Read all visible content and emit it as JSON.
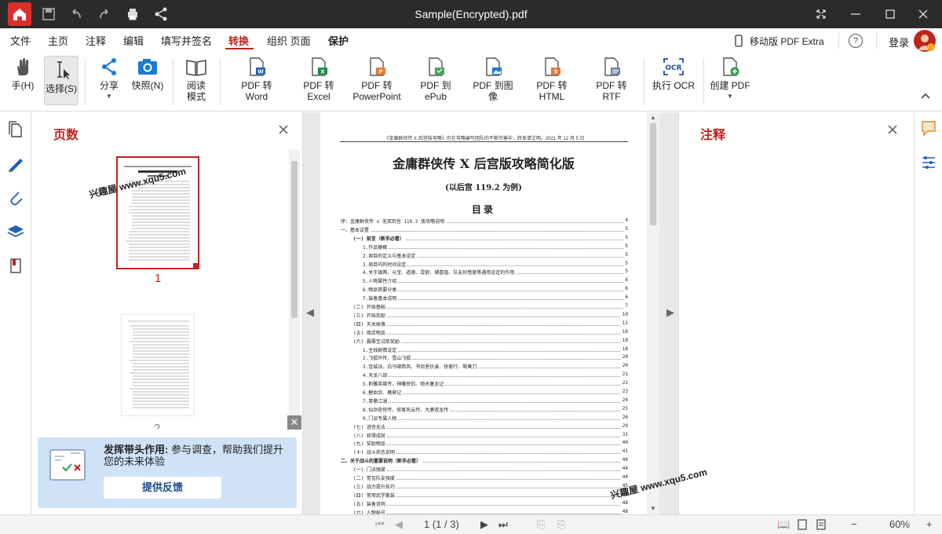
{
  "window": {
    "title": "Sample(Encrypted).pdf"
  },
  "menu": {
    "items": [
      "文件",
      "主页",
      "注释",
      "编辑",
      "填写并签名",
      "转换",
      "组织 页面",
      "保护"
    ],
    "active": "转换",
    "mobile_label": "移动版 PDF Extra",
    "help_label": "?",
    "login_label": "登录"
  },
  "ribbon": {
    "hand": "手(H)",
    "select": "选择(S)",
    "share": "分享",
    "snapshot": "快照(N)",
    "read_mode_1": "阅读",
    "read_mode_2": "模式",
    "pdf_word": "PDF 转 Word",
    "pdf_excel": "PDF 转 Excel",
    "pdf_ppt_1": "PDF 转",
    "pdf_ppt_2": "PowerPoint",
    "pdf_epub": "PDF 到 ePub",
    "pdf_image": "PDF 到图像",
    "pdf_html": "PDF 转 HTML",
    "pdf_rtf": "PDF 转 RTF",
    "ocr": "执行 OCR",
    "ocr_badge": "OCR",
    "create_pdf": "创建 PDF"
  },
  "pages_panel": {
    "title": "页数",
    "page1": "1",
    "page2": "2"
  },
  "feedback": {
    "title_bold": "发挥带头作用:",
    "title_rest": "参与调查，帮助我们提升您的未来体验",
    "button": "提供反馈"
  },
  "annotations_panel": {
    "title": "注释"
  },
  "document": {
    "header": "《金庸群侠传 X 后宫版攻略》仍在攻略编写团队的不断完善中，转发请注明。2021 年 12 月 5 日",
    "title": "金庸群侠传 X 后宫版攻略简化版",
    "subtitle": "(以后宫 119.2 为例)",
    "toc_heading": "目录",
    "toc": [
      {
        "text": "序：金庸群侠传 x 无双后宫 119.2 版攻略说明",
        "page": "4",
        "level": 0
      },
      {
        "text": "一、基本设置",
        "page": "5",
        "level": 0
      },
      {
        "text": "(一) 前言（新手必看）",
        "page": "5",
        "level": 1
      },
      {
        "text": "1.作品梗概",
        "page": "5",
        "level": 2
      },
      {
        "text": "2.周目的定义与基本设定",
        "page": "5",
        "level": 2
      },
      {
        "text": "3.周目内的时间设定",
        "page": "5",
        "level": 2
      },
      {
        "text": "4.关于银两、元宝、道德、混邪、储喜值、队友好感度等通用设定的作用",
        "page": "5",
        "level": 2
      },
      {
        "text": "5.人物属性介绍",
        "page": "6",
        "level": 2
      },
      {
        "text": "6.物品简要分类",
        "page": "6",
        "level": 2
      },
      {
        "text": "7.装备基本说明",
        "page": "6",
        "level": 2
      },
      {
        "text": "(二) 开局基础",
        "page": "7",
        "level": 1
      },
      {
        "text": "(三) 开局奖励",
        "page": "10",
        "level": 1
      },
      {
        "text": "(四) 天关掉落",
        "page": "11",
        "level": 1
      },
      {
        "text": "(五) 商店物品",
        "page": "16",
        "level": 1
      },
      {
        "text": "(六) 霸需宝试炼奖励",
        "page": "18",
        "level": 1
      },
      {
        "text": "1.主线剧情设定",
        "page": "18",
        "level": 2
      },
      {
        "text": "2.飞狐外传、雪山飞狐",
        "page": "20",
        "level": 2
      },
      {
        "text": "3.连城诀、白马啸西风、书剑恩仇录、侠客行、鸳鸯刀",
        "page": "20",
        "level": 2
      },
      {
        "text": "4.天龙八部",
        "page": "21",
        "level": 2
      },
      {
        "text": "5.射雕英雄传、神雕侠侣、倚天屠龙记",
        "page": "22",
        "level": 2
      },
      {
        "text": "6.碧血剑、鹿鼎记",
        "page": "23",
        "level": 2
      },
      {
        "text": "7.笑傲江湖",
        "page": "24",
        "level": 2
      },
      {
        "text": "8.仙剑奇侠传、侠客风云传、大唐双龙传",
        "page": "25",
        "level": 2
      },
      {
        "text": "9.门派专属人物",
        "page": "26",
        "level": 2
      },
      {
        "text": "(七) 进宫无法",
        "page": "29",
        "level": 1
      },
      {
        "text": "(八) 获得成就",
        "page": "31",
        "level": 1
      },
      {
        "text": "(九) 奖励物品",
        "page": "40",
        "level": 1
      },
      {
        "text": "(十) 战斗状态说明",
        "page": "41",
        "level": 1
      },
      {
        "text": "二、关于战斗的重要说明（新手必看）",
        "page": "44",
        "level": 0
      },
      {
        "text": "(一) 门派强度",
        "page": "44",
        "level": 1
      },
      {
        "text": "(二) 常见队友强度",
        "page": "44",
        "level": 1
      },
      {
        "text": "(三) 战力提升技巧",
        "page": "45",
        "level": 1
      },
      {
        "text": "(四) 常用武学套装",
        "page": "46",
        "level": 1
      },
      {
        "text": "(五) 装备说明",
        "page": "48",
        "level": 1
      },
      {
        "text": "(六) 人物秘号",
        "page": "48",
        "level": 1
      }
    ]
  },
  "status": {
    "page_indicator": "1 (1 / 3)",
    "zoom": "60%"
  },
  "watermark": {
    "text": "兴趣屋 www.xqu5.com"
  },
  "colors": {
    "accent": "#c0221e",
    "titlebar": "#2b2b2b"
  }
}
